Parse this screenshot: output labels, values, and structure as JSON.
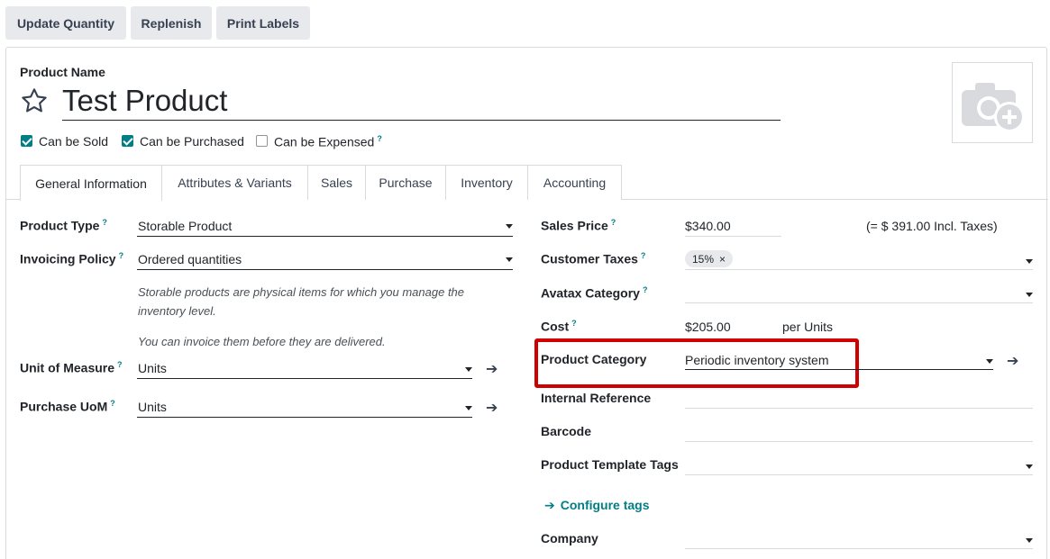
{
  "actions": {
    "update_quantity": "Update Quantity",
    "replenish": "Replenish",
    "print_labels": "Print Labels"
  },
  "product": {
    "name_label": "Product Name",
    "name": "Test Product",
    "can_be_sold": "Can be Sold",
    "can_be_purchased": "Can be Purchased",
    "can_be_expensed": "Can be Expensed",
    "help_mark": "?"
  },
  "tabs": [
    {
      "label": "General Information"
    },
    {
      "label": "Attributes & Variants"
    },
    {
      "label": "Sales"
    },
    {
      "label": "Purchase"
    },
    {
      "label": "Inventory"
    },
    {
      "label": "Accounting"
    }
  ],
  "left": {
    "product_type_label": "Product Type",
    "product_type": "Storable Product",
    "invoicing_policy_label": "Invoicing Policy",
    "invoicing_policy": "Ordered quantities",
    "help_line1": "Storable products are physical items for which you manage the",
    "help_line2": "inventory level.",
    "help_line3": "You can invoice them before they are delivered.",
    "uom_label": "Unit of Measure",
    "uom": "Units",
    "purchase_uom_label": "Purchase UoM",
    "purchase_uom": "Units"
  },
  "right": {
    "sales_price_label": "Sales Price",
    "sales_price": "$340.00",
    "incl_taxes": "(= $ 391.00 Incl. Taxes)",
    "customer_taxes_label": "Customer Taxes",
    "tax_badge": "15%",
    "tax_remove": "×",
    "avatax_label": "Avatax Category",
    "cost_label": "Cost",
    "cost": "$205.00",
    "per_units": "per Units",
    "category_label": "Product Category",
    "category": "Periodic inventory system",
    "internal_ref_label": "Internal Reference",
    "barcode_label": "Barcode",
    "tags_label": "Product Template Tags",
    "configure_tags": "Configure tags",
    "company_label": "Company"
  },
  "colors": {
    "accent": "#017e84",
    "highlight": "#d10000",
    "button_bg": "#e7e9ed"
  }
}
